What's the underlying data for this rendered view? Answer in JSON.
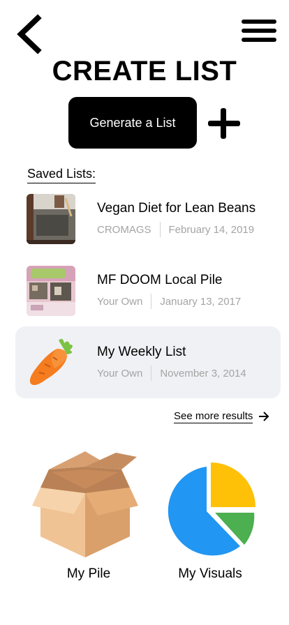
{
  "header": {
    "back_icon": "chevron-left-icon",
    "menu_icon": "hamburger-menu-icon",
    "title": "CREATE LIST"
  },
  "actions": {
    "generate_label": "Generate a List",
    "add_icon": "plus-icon"
  },
  "saved": {
    "heading": "Saved Lists:",
    "items": [
      {
        "title": "Vegan Diet for Lean Beans",
        "author": "CROMAGS",
        "date": "February 14,  2019",
        "thumb": "doorway-photo"
      },
      {
        "title": "MF DOOM Local Pile",
        "author": "Your Own",
        "date": "January 13, 2017",
        "thumb": "doom-shelf-photo"
      },
      {
        "title": "My Weekly List",
        "author": "Your Own",
        "date": "November 3,  2014",
        "thumb": "carrot-icon"
      }
    ],
    "see_more": "See more results",
    "see_more_icon": "arrow-right-icon"
  },
  "tiles": {
    "pile": {
      "label": "My Pile",
      "icon": "box-icon"
    },
    "visuals": {
      "label": "My Visuals",
      "icon": "pie-chart-icon"
    }
  },
  "colors": {
    "active_row": "#f0f1f5",
    "meta_text": "#a4a4a4",
    "pie_blue": "#2196f3",
    "pie_yellow": "#ffc107",
    "pie_green": "#4caf50",
    "carrot": "#f57c1f",
    "box": "#e8b27d"
  }
}
